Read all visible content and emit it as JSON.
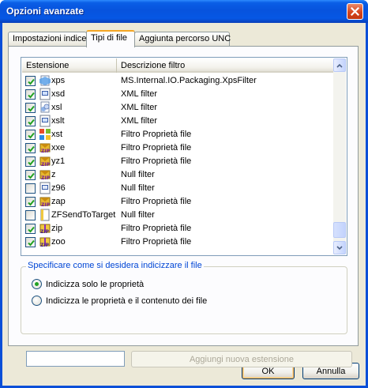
{
  "window": {
    "title": "Opzioni avanzate"
  },
  "tabs": [
    {
      "label": "Impostazioni indice",
      "active": false
    },
    {
      "label": "Tipi di file",
      "active": true
    },
    {
      "label": "Aggiunta percorso UNC",
      "active": false
    }
  ],
  "list": {
    "columns": [
      "Estensione",
      "Descrizione filtro"
    ],
    "rows": [
      {
        "checked": true,
        "icon": "xps-file-icon",
        "name": "xps",
        "desc": "MS.Internal.IO.Packaging.XpsFilter"
      },
      {
        "checked": true,
        "icon": "xml-file-icon",
        "name": "xsd",
        "desc": "XML filter"
      },
      {
        "checked": true,
        "icon": "xsl-file-icon",
        "name": "xsl",
        "desc": "XML filter"
      },
      {
        "checked": true,
        "icon": "xml-file-icon",
        "name": "xslt",
        "desc": "XML filter"
      },
      {
        "checked": true,
        "icon": "office-file-icon",
        "name": "xst",
        "desc": "Filtro Proprietà file"
      },
      {
        "checked": true,
        "icon": "archive-file-icon",
        "name": "xxe",
        "desc": "Filtro Proprietà file"
      },
      {
        "checked": true,
        "icon": "archive-file-icon",
        "name": "yz1",
        "desc": "Filtro Proprietà file"
      },
      {
        "checked": true,
        "icon": "archive-file-icon",
        "name": "z",
        "desc": "Null filter"
      },
      {
        "checked": false,
        "icon": "generic-file-icon",
        "name": "z96",
        "desc": "Null filter"
      },
      {
        "checked": true,
        "icon": "archive-file-icon",
        "name": "zap",
        "desc": "Filtro Proprietà file"
      },
      {
        "checked": false,
        "icon": "sendto-file-icon",
        "name": "ZFSendToTarget",
        "desc": "Null filter"
      },
      {
        "checked": true,
        "icon": "zip-file-icon",
        "name": "zip",
        "desc": "Filtro Proprietà file"
      },
      {
        "checked": true,
        "icon": "zip-file-icon",
        "name": "zoo",
        "desc": "Filtro Proprietà file"
      }
    ]
  },
  "index_mode": {
    "legend": "Specificare come si desidera indicizzare il file",
    "options": [
      {
        "label": "Indicizza solo le proprietà",
        "selected": true
      },
      {
        "label": "Indicizza le proprietà e il contenuto dei file",
        "selected": false
      }
    ]
  },
  "new_extension": {
    "value": "",
    "button_label": "Aggiungi nuova estensione"
  },
  "buttons": {
    "ok": "OK",
    "cancel": "Annulla"
  },
  "colors": {
    "title_bar": "#0753dd",
    "dialog_bg": "#ece9d8",
    "legend_text": "#0046d5",
    "active_tab_accent": "#f5a623"
  }
}
